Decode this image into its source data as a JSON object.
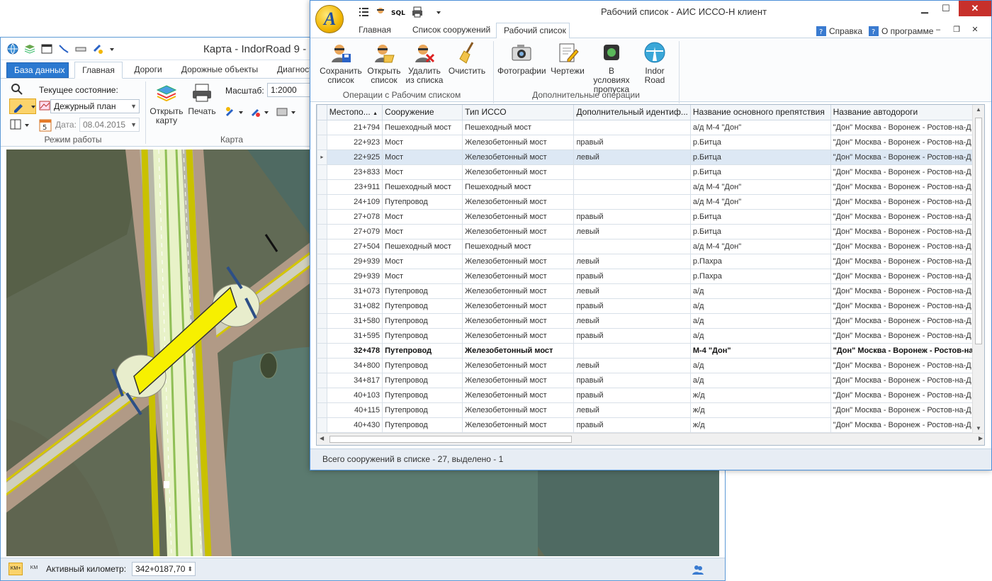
{
  "map_window": {
    "title": "Карта - IndorRoad 9 -",
    "tabs": [
      "База данных",
      "Главная",
      "Дороги",
      "Дорожные объекты",
      "Диагност"
    ],
    "active_tab_index": 1,
    "ribbon": {
      "state_label": "Текущее состояние:",
      "state_value": "Дежурный план",
      "date_label": "Дата:",
      "date_value": "08.04.2015",
      "mode_group_label": "Режим работы",
      "open_map_label": "Открыть карту",
      "print_label": "Печать",
      "scale_label": "Масштаб:",
      "scale_value": "1:2000",
      "map_group_label": "Карта"
    },
    "statusbar": {
      "km_plus_badge": "KM+",
      "km_badge": "KM",
      "active_km_label": "Активный километр:",
      "active_km_value": "342+0187,70"
    }
  },
  "list_window": {
    "title": "Рабочий список - АИС ИССО-Н клиент",
    "orb_letter": "A",
    "qat_sql": "SQL",
    "tabs": [
      "Главная",
      "Список сооружений",
      "Рабочий список"
    ],
    "active_tab_index": 2,
    "help": "Справка",
    "about": "О программе",
    "ribbon": {
      "buttons_ops": [
        {
          "label1": "Сохранить",
          "label2": "список"
        },
        {
          "label1": "Открыть",
          "label2": "список"
        },
        {
          "label1": "Удалить",
          "label2": "из списка"
        },
        {
          "label1": "Очистить",
          "label2": ""
        }
      ],
      "ops_group_label": "Операции с Рабочим списком",
      "buttons_extra": [
        {
          "label1": "Фотографии",
          "label2": ""
        },
        {
          "label1": "Чертежи",
          "label2": ""
        },
        {
          "label1": "В условиях",
          "label2": "пропуска"
        },
        {
          "label1": "Indor",
          "label2": "Road"
        }
      ],
      "extra_group_label": "Дополнительные операции"
    },
    "columns": [
      "Местопо...",
      "Сооружение",
      "Тип ИССО",
      "Дополнительный идентиф...",
      "Название основного препятствия",
      "Название автодороги"
    ],
    "rows": [
      [
        "21+794",
        "Пешеходный мост",
        "Пешеходный мост",
        "",
        "а/д М-4 \"Дон\"",
        "\"Дон\" Москва - Воронеж - Ростов-на-Д"
      ],
      [
        "22+923",
        "Мост",
        "Железобетонный мост",
        "правый",
        "р.Битца",
        "\"Дон\" Москва - Воронеж - Ростов-на-Д"
      ],
      [
        "22+925",
        "Мост",
        "Железобетонный мост",
        "левый",
        "р.Битца",
        "\"Дон\" Москва - Воронеж - Ростов-на-Д"
      ],
      [
        "23+833",
        "Мост",
        "Железобетонный мост",
        "",
        "р.Битца",
        "\"Дон\" Москва - Воронеж - Ростов-на-Д"
      ],
      [
        "23+911",
        "Пешеходный мост",
        "Пешеходный мост",
        "",
        "а/д М-4 \"Дон\"",
        "\"Дон\" Москва - Воронеж - Ростов-на-Д"
      ],
      [
        "24+109",
        "Путепровод",
        "Железобетонный мост",
        "",
        "а/д М-4 \"Дон\"",
        "\"Дон\" Москва - Воронеж - Ростов-на-Д"
      ],
      [
        "27+078",
        "Мост",
        "Железобетонный мост",
        "правый",
        "р.Битца",
        "\"Дон\" Москва - Воронеж - Ростов-на-Д"
      ],
      [
        "27+079",
        "Мост",
        "Железобетонный мост",
        "левый",
        "р.Битца",
        "\"Дон\" Москва - Воронеж - Ростов-на-Д"
      ],
      [
        "27+504",
        "Пешеходный мост",
        "Пешеходный мост",
        "",
        "а/д М-4 \"Дон\"",
        "\"Дон\" Москва - Воронеж - Ростов-на-Д"
      ],
      [
        "29+939",
        "Мост",
        "Железобетонный мост",
        "левый",
        "р.Пахра",
        "\"Дон\" Москва - Воронеж - Ростов-на-Д"
      ],
      [
        "29+939",
        "Мост",
        "Железобетонный мост",
        "правый",
        "р.Пахра",
        "\"Дон\" Москва - Воронеж - Ростов-на-Д"
      ],
      [
        "31+073",
        "Путепровод",
        "Железобетонный мост",
        "левый",
        "а/д",
        "\"Дон\" Москва - Воронеж - Ростов-на-Д"
      ],
      [
        "31+082",
        "Путепровод",
        "Железобетонный мост",
        "правый",
        "а/д",
        "\"Дон\" Москва - Воронеж - Ростов-на-Д"
      ],
      [
        "31+580",
        "Путепровод",
        "Железобетонный мост",
        "левый",
        "а/д",
        "\"Дон\" Москва - Воронеж - Ростов-на-Д"
      ],
      [
        "31+595",
        "Путепровод",
        "Железобетонный мост",
        "правый",
        "а/д",
        "\"Дон\" Москва - Воронеж - Ростов-на-Д"
      ],
      [
        "32+478",
        "Путепровод",
        "Железобетонный мост",
        "",
        "М-4 \"Дон\"",
        "\"Дон\" Москва - Воронеж - Ростов-на-Д"
      ],
      [
        "34+800",
        "Путепровод",
        "Железобетонный мост",
        "левый",
        "а/д",
        "\"Дон\" Москва - Воронеж - Ростов-на-Д"
      ],
      [
        "34+817",
        "Путепровод",
        "Железобетонный мост",
        "правый",
        "а/д",
        "\"Дон\" Москва - Воронеж - Ростов-на-Д"
      ],
      [
        "40+103",
        "Путепровод",
        "Железобетонный мост",
        "правый",
        "ж/д",
        "\"Дон\" Москва - Воронеж - Ростов-на-Д"
      ],
      [
        "40+115",
        "Путепровод",
        "Железобетонный мост",
        "левый",
        "ж/д",
        "\"Дон\" Москва - Воронеж - Ростов-на-Д"
      ],
      [
        "40+430",
        "Путепровод",
        "Железобетонный мост",
        "правый",
        "ж/д",
        "\"Дон\" Москва - Воронеж - Ростов-на-Д"
      ]
    ],
    "selected_row_index": 2,
    "bold_row_index": 15,
    "statusbar": "Всего сооружений в списке - 27, выделено - 1"
  },
  "colors": {
    "accent": "#2b79d0",
    "close": "#c7302b",
    "selection": "#dde8f4"
  }
}
